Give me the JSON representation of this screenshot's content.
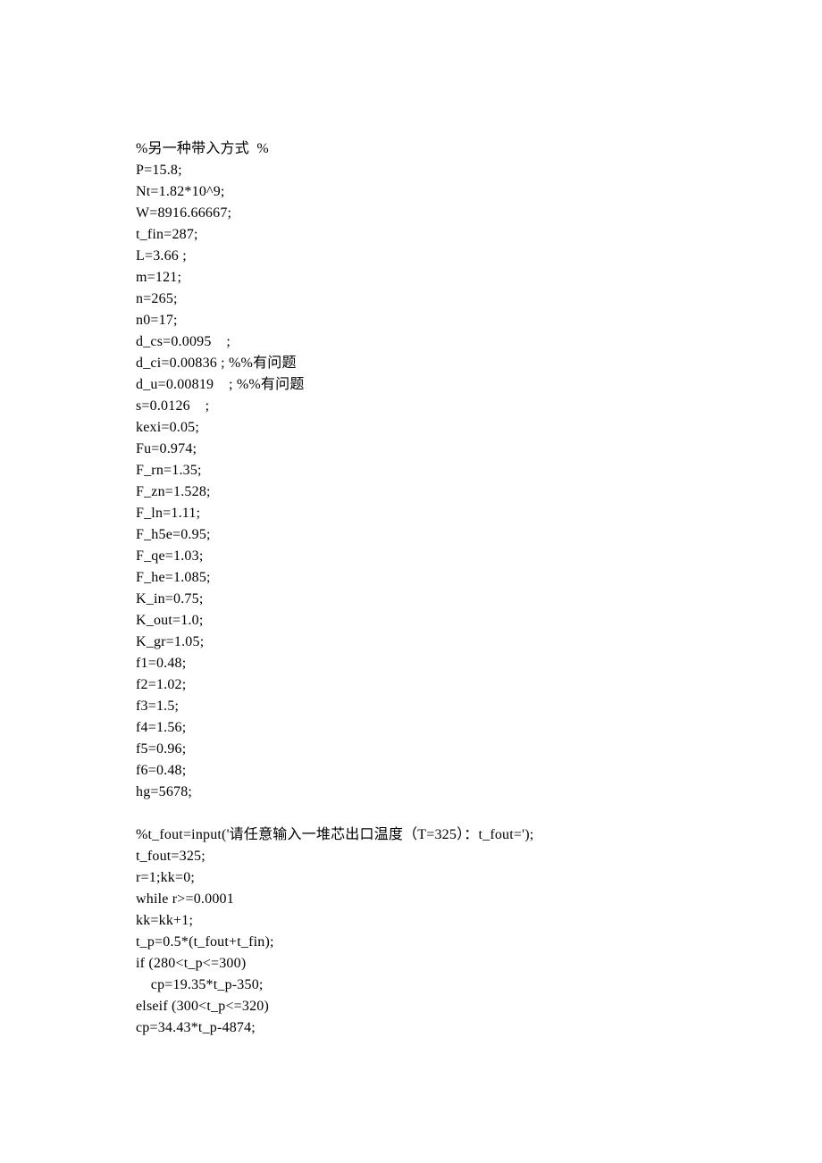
{
  "lines": [
    "%另一种带入方式  %",
    "P=15.8;",
    "Nt=1.82*10^9;",
    "W=8916.66667;",
    "t_fin=287;",
    "L=3.66 ;",
    "m=121;",
    "n=265;",
    "n0=17;",
    "d_cs=0.0095    ;",
    "d_ci=0.00836 ; %%有问题",
    "d_u=0.00819    ; %%有问题",
    "s=0.0126    ;",
    "kexi=0.05;",
    "Fu=0.974;",
    "F_rn=1.35;",
    "F_zn=1.528;",
    "F_ln=1.11;",
    "F_h5e=0.95;",
    "F_qe=1.03;",
    "F_he=1.085;",
    "K_in=0.75;",
    "K_out=1.0;",
    "K_gr=1.05;",
    "f1=0.48;",
    "f2=1.02;",
    "f3=1.5;",
    "f4=1.56;",
    "f5=0.96;",
    "f6=0.48;",
    "hg=5678;",
    "",
    "%t_fout=input('请任意输入一堆芯出口温度（T=325）：t_fout=');",
    "t_fout=325;",
    "r=1;kk=0;",
    "while r>=0.0001",
    "kk=kk+1;",
    "t_p=0.5*(t_fout+t_fin);",
    "if (280<t_p<=300)",
    "    cp=19.35*t_p-350;",
    "elseif (300<t_p<=320)",
    "cp=34.43*t_p-4874;"
  ]
}
